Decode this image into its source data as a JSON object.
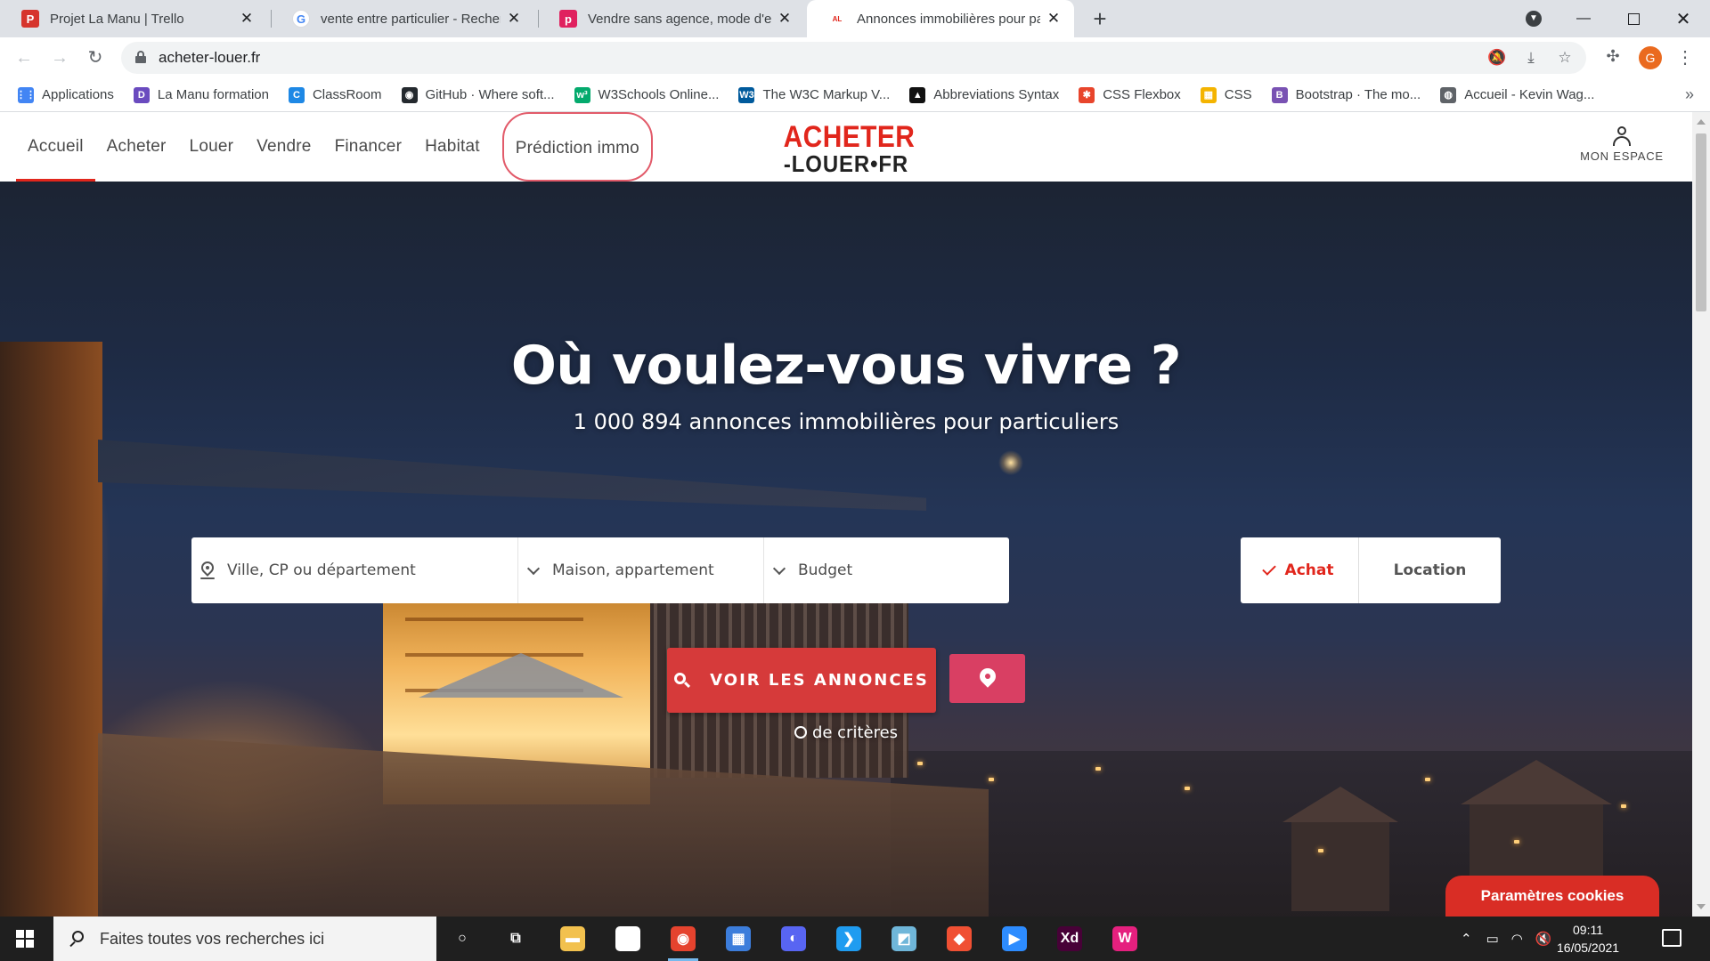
{
  "browser": {
    "tabs": [
      {
        "label": "Projet La Manu | Trello",
        "favicon": "trello-icon",
        "color": "#d6342c",
        "active": false
      },
      {
        "label": "vente entre particulier - Recherch",
        "favicon": "google-icon",
        "color": "#4285f4",
        "active": false
      },
      {
        "label": "Vendre sans agence, mode d'emp",
        "favicon": "pap-icon",
        "color": "#e0215f",
        "active": false
      },
      {
        "label": "Annonces immobilières pour par",
        "favicon": "acheter-louer-icon",
        "color": "#e1261c",
        "active": true
      }
    ],
    "favicon_letters": {
      "trello": "P",
      "google": "G",
      "pap": "p",
      "acheter": "AL"
    },
    "new_tab": "+",
    "url": "acheter-louer.fr",
    "profile_initial": "G",
    "bookmarks": [
      {
        "label": "Applications",
        "icon": "apps-grid-icon",
        "color": "#4285f4",
        "glyph": "⋮⋮"
      },
      {
        "label": "La Manu formation",
        "icon": "lamanu-icon",
        "color": "#6a4bbf",
        "glyph": "D"
      },
      {
        "label": "ClassRoom",
        "icon": "classroom-icon",
        "color": "#1e88e5",
        "glyph": "C"
      },
      {
        "label": "GitHub · Where soft...",
        "icon": "github-icon",
        "color": "#24292e",
        "glyph": "◉"
      },
      {
        "label": "W3Schools Online...",
        "icon": "w3schools-icon",
        "color": "#04aa6d",
        "glyph": "w³"
      },
      {
        "label": "The W3C Markup V...",
        "icon": "w3c-icon",
        "color": "#005a9c",
        "glyph": "W3"
      },
      {
        "label": "Abbreviations Syntax",
        "icon": "abbreviations-icon",
        "color": "#111111",
        "glyph": "▲"
      },
      {
        "label": "CSS Flexbox",
        "icon": "flexbox-icon",
        "color": "#e8452c",
        "glyph": "✱"
      },
      {
        "label": "CSS",
        "icon": "css-icon",
        "color": "#f4b400",
        "glyph": "▦"
      },
      {
        "label": "Bootstrap · The mo...",
        "icon": "bootstrap-icon",
        "color": "#7952b3",
        "glyph": "B"
      },
      {
        "label": "Accueil - Kevin Wag...",
        "icon": "globe-icon",
        "color": "#5f6368",
        "glyph": "◍"
      }
    ],
    "bookmarks_more": "»"
  },
  "site": {
    "nav": [
      "Accueil",
      "Acheter",
      "Louer",
      "Vendre",
      "Financer",
      "Habitat"
    ],
    "prediction": "Prédiction immo",
    "logo_line1": "ACHETER",
    "logo_line2": "-LOUER•FR",
    "account": "MON ESPACE"
  },
  "hero": {
    "title": "Où voulez-vous vivre ?",
    "subtitle": "1 000 894 annonces immobilières pour particuliers",
    "location_placeholder": "Ville, CP ou département",
    "type_label": "Maison, appartement",
    "budget_label": "Budget",
    "achat": "Achat",
    "location": "Location",
    "cta": "VOIR LES ANNONCES",
    "criteria": "de critères",
    "cookies": "Paramètres cookies"
  },
  "taskbar": {
    "search_placeholder": "Faites toutes vos recherches ici",
    "apps": [
      {
        "name": "cortana-icon",
        "glyph": "○",
        "color": "transparent"
      },
      {
        "name": "task-view-icon",
        "glyph": "⧉",
        "color": "transparent"
      },
      {
        "name": "file-explorer-icon",
        "glyph": "▬",
        "color": "#f2c14e"
      },
      {
        "name": "store-icon",
        "glyph": "🛍",
        "color": "#ffffff"
      },
      {
        "name": "chrome-icon",
        "glyph": "◉",
        "color": "#e5432e"
      },
      {
        "name": "calculator-icon",
        "glyph": "▦",
        "color": "#3c7ddb"
      },
      {
        "name": "discord-icon",
        "glyph": "◐",
        "color": "#5865f2"
      },
      {
        "name": "vscode-icon",
        "glyph": "❯",
        "color": "#1f9cf0"
      },
      {
        "name": "notes-icon",
        "glyph": "◩",
        "color": "#6fb6d9"
      },
      {
        "name": "git-icon",
        "glyph": "◆",
        "color": "#f05033"
      },
      {
        "name": "zoom-icon",
        "glyph": "▶",
        "color": "#2d8cff"
      },
      {
        "name": "adobe-xd-icon",
        "glyph": "Xd",
        "color": "#470137"
      },
      {
        "name": "wamp-icon",
        "glyph": "W",
        "color": "#e5207e"
      }
    ],
    "time": "09:11",
    "date": "16/05/2021"
  }
}
